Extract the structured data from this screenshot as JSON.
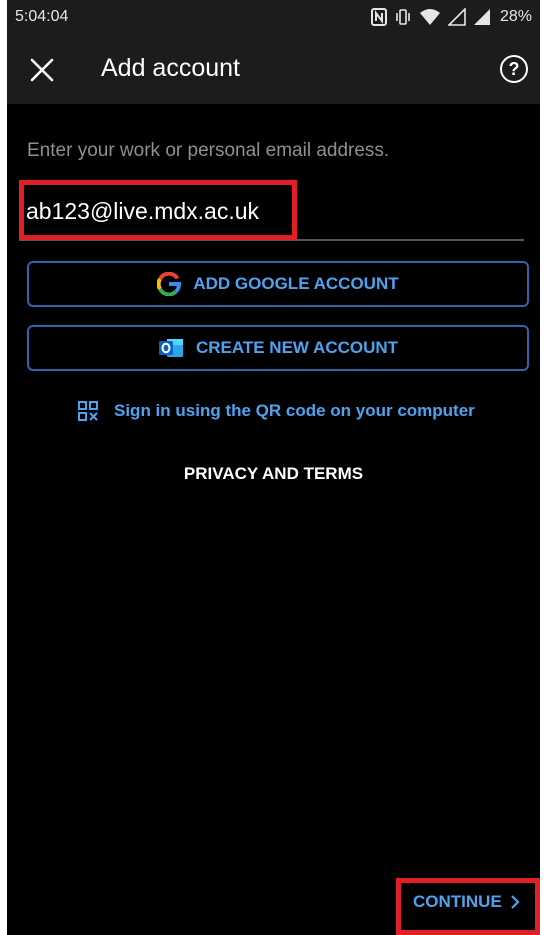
{
  "status_bar": {
    "time": "5:04:04",
    "battery": "28%",
    "icons": [
      "nfc-icon",
      "vibrate-icon",
      "wifi-icon",
      "signal-icon",
      "signal-full-icon"
    ]
  },
  "app_bar": {
    "title": "Add account",
    "close_icon": "close-icon",
    "help_icon": "help-icon",
    "help_glyph": "?"
  },
  "form": {
    "prompt": "Enter your work or personal email address.",
    "email_value": "ab123@live.mdx.ac.uk"
  },
  "buttons": {
    "google": "ADD GOOGLE ACCOUNT",
    "create": "CREATE NEW ACCOUNT",
    "qr": "Sign in using the QR code on your computer",
    "privacy": "PRIVACY AND TERMS",
    "continue": "CONTINUE"
  },
  "colors": {
    "accent": "#4ea3f0",
    "button_border": "#2f68a8",
    "highlight": "#e21f26",
    "background": "#000000",
    "bar": "#1c1c1c",
    "outlook_blue": "#0a62c4"
  }
}
